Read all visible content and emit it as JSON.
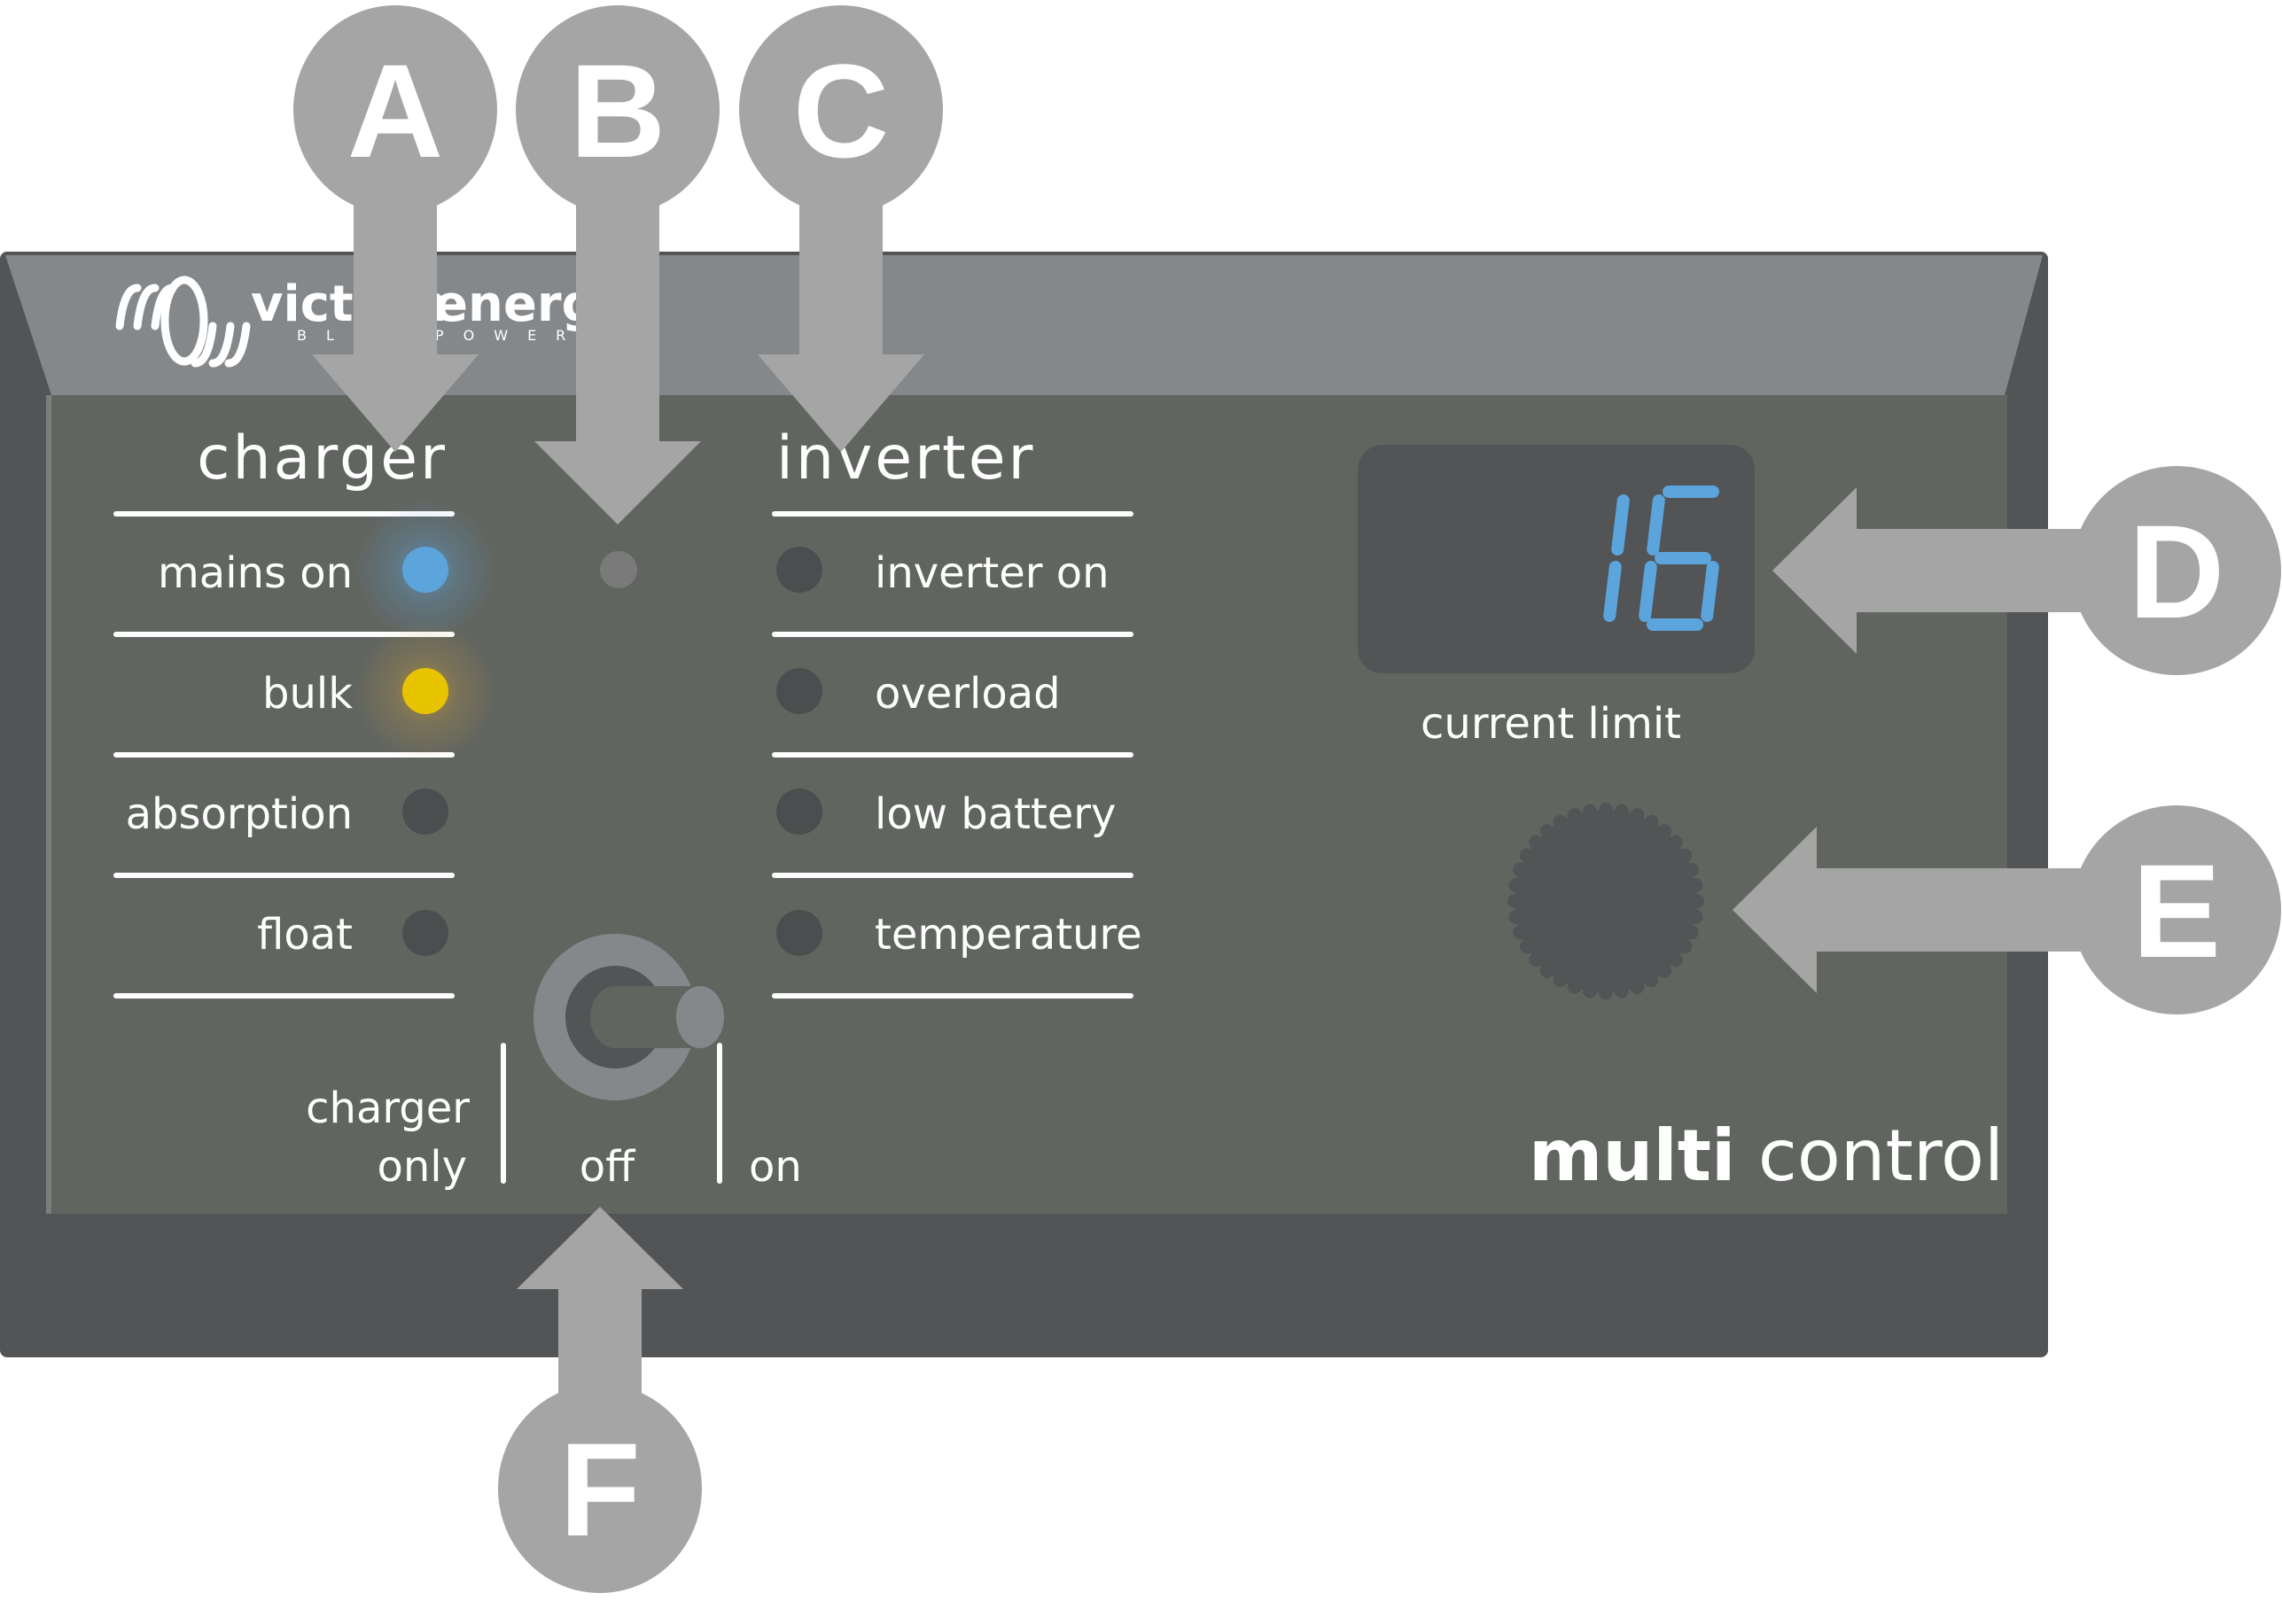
{
  "device": {
    "brand": {
      "name_left": "victron",
      "name_right": "energy",
      "tagline": "BLUE POWER"
    },
    "product": {
      "bold": "multi",
      "regular": " control"
    },
    "colors": {
      "outer": "#525456",
      "top_band": "#85888a",
      "panel": "#616560",
      "callout": "#a5a5a5",
      "led_blue": "#5ca4dc",
      "led_yellow": "#e8c400",
      "led_off": "#4b4d4f",
      "led_grey": "#7a7a7a",
      "display_bg": "#525456",
      "display_digits": "#5ca4dc",
      "knob": "#525456"
    },
    "charger": {
      "title": "charger",
      "leds": [
        {
          "label": "mains on",
          "state": "on",
          "color": "blue"
        },
        {
          "label": "bulk",
          "state": "on",
          "color": "yellow"
        },
        {
          "label": "absorption",
          "state": "off",
          "color": "off"
        },
        {
          "label": "float",
          "state": "off",
          "color": "off"
        }
      ]
    },
    "middle_led": {
      "state": "off",
      "color": "grey"
    },
    "inverter": {
      "title": "inverter",
      "leds": [
        {
          "label": "inverter on",
          "state": "off"
        },
        {
          "label": "overload",
          "state": "off"
        },
        {
          "label": "low battery",
          "state": "off"
        },
        {
          "label": "temperature",
          "state": "off"
        }
      ]
    },
    "switch": {
      "positions": [
        "charger only",
        "off",
        "on"
      ],
      "position_line1": "charger",
      "position_line2": "only",
      "off_label": "off",
      "on_label": "on",
      "current_position": "on"
    },
    "display": {
      "value": "16",
      "label": "current limit"
    },
    "knob": {
      "name": "current limit knob"
    }
  },
  "callouts": [
    {
      "letter": "A",
      "target": "charger status LEDs"
    },
    {
      "letter": "B",
      "target": "middle LED"
    },
    {
      "letter": "C",
      "target": "inverter status LEDs"
    },
    {
      "letter": "D",
      "target": "current limit display"
    },
    {
      "letter": "E",
      "target": "current limit knob"
    },
    {
      "letter": "F",
      "target": "mode switch"
    }
  ]
}
